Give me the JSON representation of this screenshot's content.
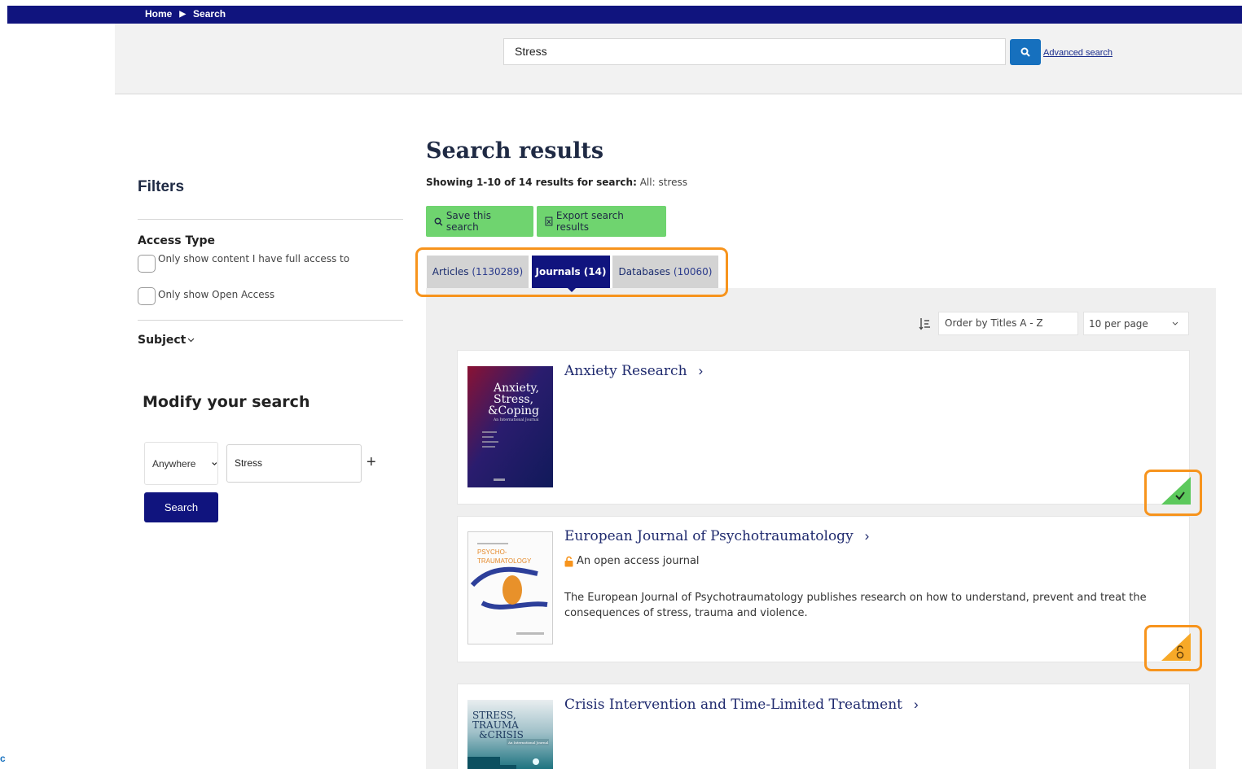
{
  "breadcrumb": {
    "home": "Home",
    "current": "Search"
  },
  "top_search": {
    "query": "Stress",
    "advanced_link": "Advanced search"
  },
  "filters": {
    "title": "Filters",
    "access_type_title": "Access Type",
    "option_full_access": "Only show content I have full access to",
    "option_open_access": "Only show Open Access",
    "subject_label": "Subject"
  },
  "modify": {
    "title": "Modify your search",
    "field_select": "Anywhere",
    "term": "Stress",
    "add_symbol": "+",
    "search_button": "Search"
  },
  "results": {
    "title": "Search results",
    "showing_prefix": "Showing 1-10 of 14 results for search:",
    "showing_query": "All: stress",
    "save_button": "Save this search",
    "export_button": "Export search results"
  },
  "tabs": [
    {
      "label": "Articles",
      "count": "(1130289)"
    },
    {
      "label": "Journals",
      "count": "(14)"
    },
    {
      "label": "Databases",
      "count": "(10060)"
    }
  ],
  "controls": {
    "order": "Order by Titles A - Z",
    "per_page": "10 per page"
  },
  "journals": [
    {
      "title": "Anxiety Research",
      "cover_text": [
        "Anxiety,",
        "Stress,",
        "&Coping"
      ],
      "cover_sub": "An International Journal"
    },
    {
      "title": "European Journal of Psychotraumatology",
      "cover_text": [
        "PSYCHO-",
        "TRAUMATOLOGY"
      ],
      "oa_label": "An open access journal",
      "description": "The European Journal of Psychotraumatology publishes research on how to understand, prevent and treat the consequences of stress, trauma and violence."
    },
    {
      "title": "Crisis Intervention and Time-Limited Treatment",
      "cover_text": [
        "STRESS,",
        "TRAUMA",
        "&CRISIS"
      ],
      "cover_sub": "An International Journal"
    }
  ],
  "colors": {
    "nav": "#10147e",
    "accent_orange": "#f7941d",
    "green_button": "#6fd46f",
    "search_blue": "#1670be"
  },
  "side_link": "c"
}
